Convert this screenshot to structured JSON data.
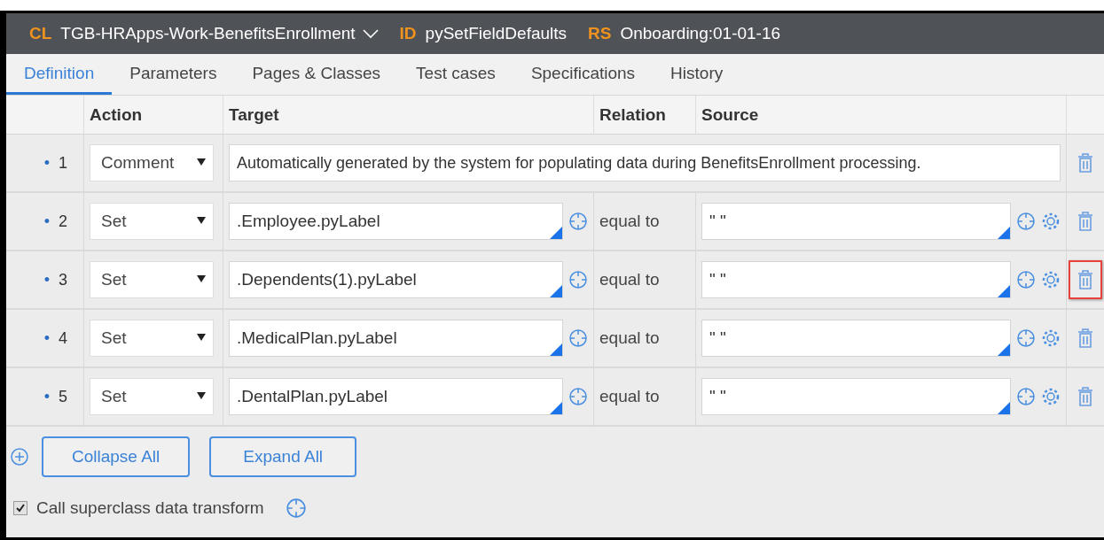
{
  "header": {
    "class_label": "CL",
    "class_name": "TGB-HRApps-Work-BenefitsEnrollment",
    "id_label": "ID",
    "id_value": "pySetFieldDefaults",
    "ruleset_label": "RS",
    "ruleset_value": "Onboarding:01-01-16"
  },
  "tabs": [
    {
      "label": "Definition",
      "selected": true
    },
    {
      "label": "Parameters",
      "selected": false
    },
    {
      "label": "Pages & Classes",
      "selected": false
    },
    {
      "label": "Test cases",
      "selected": false
    },
    {
      "label": "Specifications",
      "selected": false
    },
    {
      "label": "History",
      "selected": false
    }
  ],
  "table": {
    "columns": [
      "Action",
      "Target",
      "Relation",
      "Source"
    ],
    "rows": [
      {
        "kind": "comment",
        "bullet": "•",
        "number": "1",
        "action": "Comment",
        "text": "Automatically generated by the system for populating data during BenefitsEnrollment processing.",
        "highlighted": false
      },
      {
        "kind": "set",
        "bullet": "•",
        "number": "2",
        "action": "Set",
        "target": ".Employee.pyLabel",
        "relation": "equal to",
        "source": "\" \"",
        "highlighted": false
      },
      {
        "kind": "set",
        "bullet": "•",
        "number": "3",
        "action": "Set",
        "target": ".Dependents(1).pyLabel",
        "relation": "equal to",
        "source": "\" \"",
        "highlighted": true
      },
      {
        "kind": "set",
        "bullet": "•",
        "number": "4",
        "action": "Set",
        "target": ".MedicalPlan.pyLabel",
        "relation": "equal to",
        "source": "\" \"",
        "highlighted": false
      },
      {
        "kind": "set",
        "bullet": "•",
        "number": "5",
        "action": "Set",
        "target": ".DentalPlan.pyLabel",
        "relation": "equal to",
        "source": "\" \"",
        "highlighted": false
      }
    ]
  },
  "buttons": [
    "Collapse All",
    "Expand All"
  ],
  "superclass": {
    "label": "Call superclass data transform",
    "checked": true
  }
}
